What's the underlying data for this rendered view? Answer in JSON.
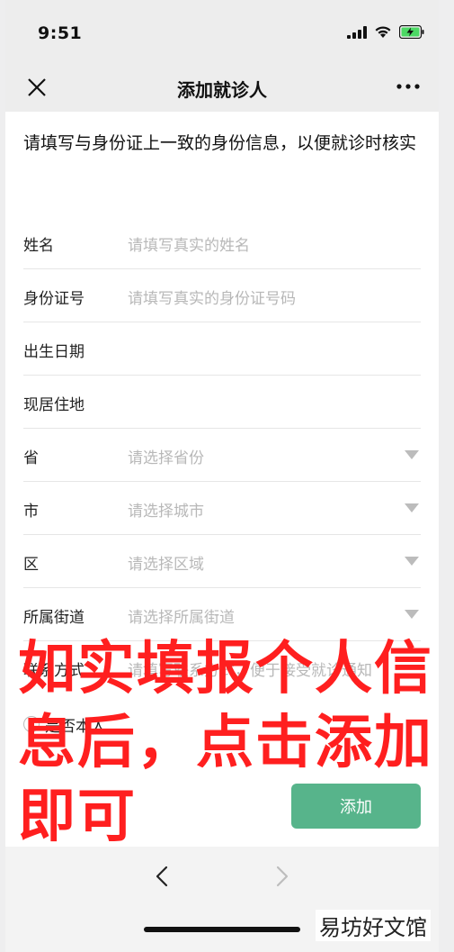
{
  "status_bar": {
    "time": "9:51"
  },
  "nav": {
    "title": "添加就诊人"
  },
  "notice": "请填写与身份证上一致的身份信息，以便就诊时核实",
  "form": {
    "rows": [
      {
        "label": "姓名",
        "placeholder": "请填写真实的姓名",
        "dropdown": false
      },
      {
        "label": "身份证号",
        "placeholder": "请填写真实的身份证号码",
        "dropdown": false
      },
      {
        "label": "出生日期",
        "placeholder": "",
        "dropdown": false
      },
      {
        "label": "现居住地",
        "placeholder": "",
        "dropdown": false
      },
      {
        "label": "省",
        "placeholder": "请选择省份",
        "dropdown": true
      },
      {
        "label": "市",
        "placeholder": "请选择城市",
        "dropdown": true
      },
      {
        "label": "区",
        "placeholder": "请选择区域",
        "dropdown": true
      },
      {
        "label": "所属街道",
        "placeholder": "请选择所属街道",
        "dropdown": true
      },
      {
        "label": "联系方式",
        "placeholder": "请填写联系方式，便于接受就诊通知",
        "dropdown": false
      }
    ],
    "self_label": "是否本人",
    "add_button": "添加"
  },
  "annotation": "如实填报个人信息后，点击添加即可",
  "watermark": "易坊好文馆",
  "colors": {
    "accent_button": "#57b48b",
    "annotation": "#ff1f1f"
  }
}
